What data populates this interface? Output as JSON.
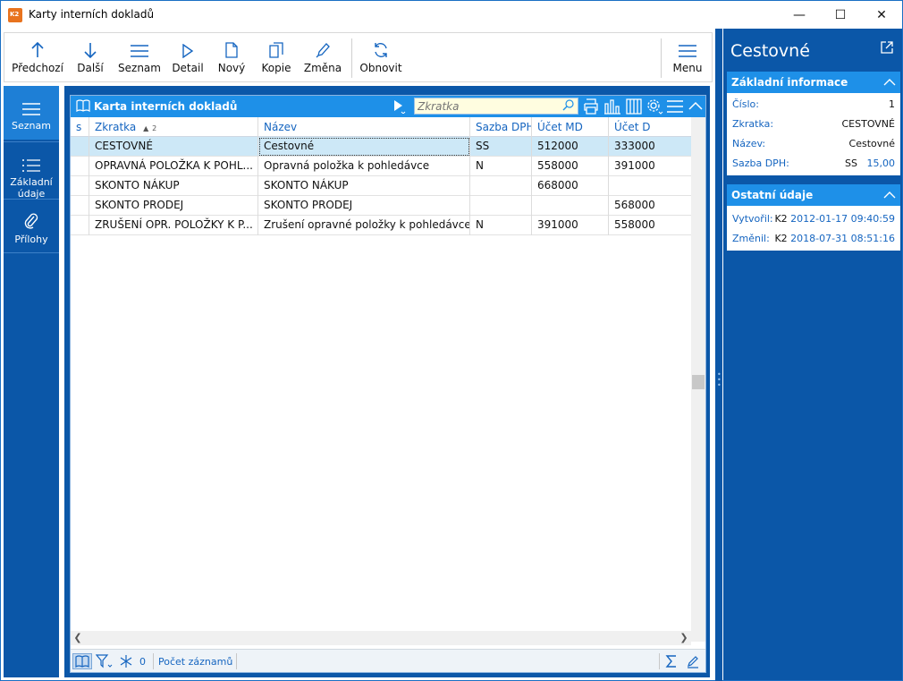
{
  "window": {
    "title": "Karty interních dokladů",
    "minimize": "—",
    "maximize": "☐",
    "close": "✕"
  },
  "toolbar": {
    "prev": "Předchozí",
    "next": "Další",
    "list": "Seznam",
    "detail": "Detail",
    "new": "Nový",
    "copy": "Kopie",
    "change": "Změna",
    "refresh": "Obnovit",
    "menu": "Menu"
  },
  "leftnav": {
    "items": [
      {
        "label": "Seznam",
        "icon": "list-lines-icon",
        "active": true
      },
      {
        "label": "Základní údaje",
        "icon": "list-bullets-icon",
        "active": false
      },
      {
        "label": "Přílohy",
        "icon": "paperclip-icon",
        "active": false
      }
    ]
  },
  "grid": {
    "title": "Karta interních dokladů",
    "search_placeholder": "Zkratka",
    "columns": [
      "s",
      "Zkratka",
      "Název",
      "Sazba DPH",
      "Účet MD",
      "Účet D"
    ],
    "sort_index": "2",
    "rows": [
      {
        "s": "",
        "zkratka": "CESTOVNÉ",
        "nazev": "Cestovné",
        "sazba": "SS",
        "md": "512000",
        "d": "333000"
      },
      {
        "s": "",
        "zkratka": "OPRAVNÁ POLOŽKA K POHL...",
        "nazev": "Opravná položka k pohledávce",
        "sazba": "N",
        "md": "558000",
        "d": "391000"
      },
      {
        "s": "",
        "zkratka": "SKONTO NÁKUP",
        "nazev": "SKONTO NÁKUP",
        "sazba": "",
        "md": "668000",
        "d": ""
      },
      {
        "s": "",
        "zkratka": "SKONTO PRODEJ",
        "nazev": "SKONTO PRODEJ",
        "sazba": "",
        "md": "",
        "d": "568000"
      },
      {
        "s": "",
        "zkratka": "ZRUŠENÍ OPR. POLOŽKY K P...",
        "nazev": "Zrušení opravné položky k pohledávce",
        "sazba": "N",
        "md": "391000",
        "d": "558000"
      }
    ],
    "status": {
      "filter_count": "0",
      "record_count_label": "Počet záznamů"
    }
  },
  "detail": {
    "title": "Cestovné",
    "basic": {
      "header": "Základní informace",
      "cislo_label": "Číslo:",
      "cislo": "1",
      "zkratka_label": "Zkratka:",
      "zkratka": "CESTOVNÉ",
      "nazev_label": "Název:",
      "nazev": "Cestovné",
      "sazba_label": "Sazba DPH:",
      "sazba_code": "SS",
      "sazba_value": "15,00"
    },
    "other": {
      "header": "Ostatní údaje",
      "created_label": "Vytvořil:",
      "created_user": "K2",
      "created_at": "2012-01-17 09:40:59",
      "changed_label": "Změnil:",
      "changed_user": "K2",
      "changed_at": "2018-07-31 08:51:16"
    }
  },
  "colors": {
    "accent_dark": "#0b57a8",
    "accent_light": "#1e90e8",
    "selection": "#cde8f7",
    "link_blue": "#1565c0"
  }
}
